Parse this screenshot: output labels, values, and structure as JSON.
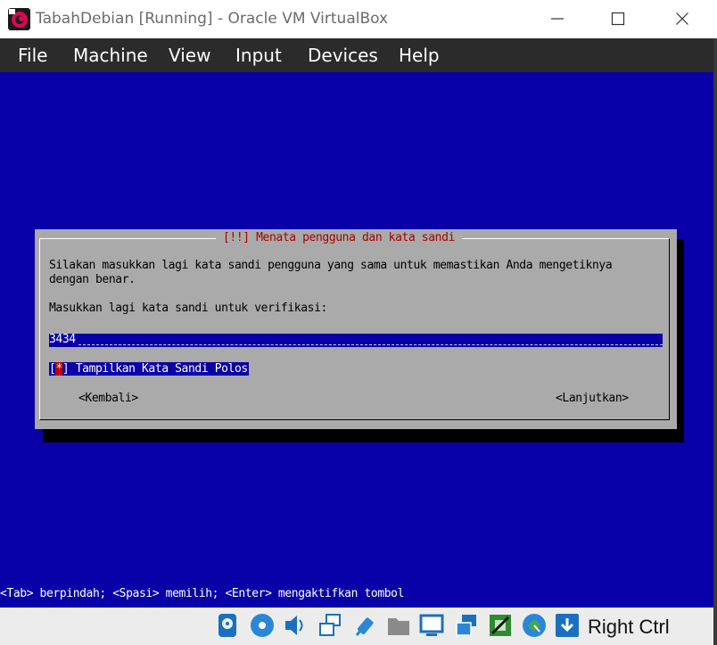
{
  "window": {
    "title": "TabahDebian [Running] - Oracle VM VirtualBox"
  },
  "menu": {
    "items": [
      "File",
      "Machine",
      "View",
      "Input",
      "Devices",
      "Help"
    ]
  },
  "installer": {
    "dialog_title": "[!!] Menata pengguna dan kata sandi",
    "description_line1": "Silakan masukkan lagi kata sandi pengguna yang sama untuk memastikan Anda mengetiknya",
    "description_line2": "dengan benar.",
    "prompt": "Masukkan lagi kata sandi untuk verifikasi:",
    "password_value": "3434",
    "checkbox_open": "[",
    "checkbox_mark": "*",
    "checkbox_close": "] Tampilkan Kata Sandi Polos",
    "back_button": "<Kembali>",
    "continue_button": "<Lanjutkan>",
    "help_line": "<Tab> berpindah; <Spasi> memilih; <Enter> mengaktifkan tombol"
  },
  "statusbar": {
    "host_key": "Right Ctrl",
    "icons": [
      "hard-disk-icon",
      "optical-drive-icon",
      "audio-icon",
      "network-icon",
      "usb-icon",
      "shared-folders-icon",
      "display-icon",
      "video-capture-icon",
      "cpu-icon",
      "mouse-integration-icon",
      "keyboard-capture-icon"
    ]
  },
  "colors": {
    "vm_background": "#0a00a8",
    "dialog_background": "#aaaaaa",
    "dialog_title": "#a80000",
    "menubar": "#2b2b2b"
  }
}
